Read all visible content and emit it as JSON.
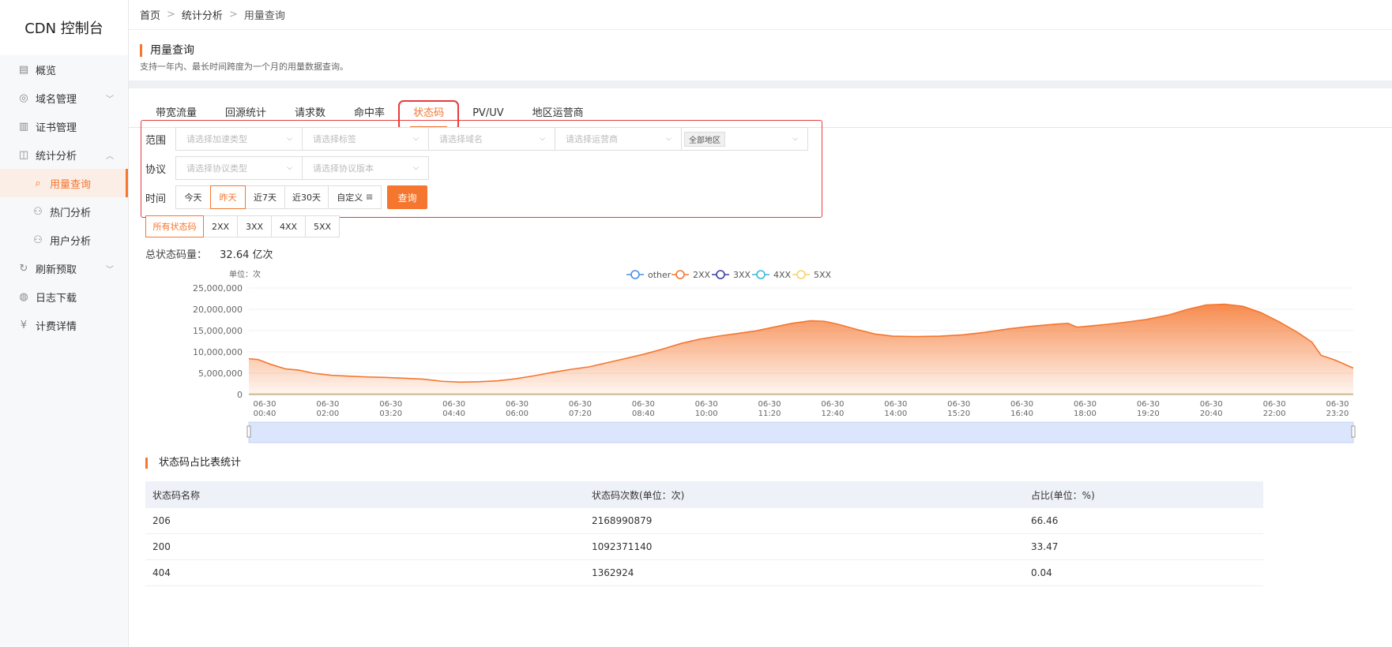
{
  "app": {
    "title": "CDN 控制台"
  },
  "sidebar": {
    "items": [
      {
        "label": "概览",
        "icon": "overview-icon"
      },
      {
        "label": "域名管理",
        "icon": "domain-icon",
        "expandable": true
      },
      {
        "label": "证书管理",
        "icon": "certificate-icon"
      },
      {
        "label": "统计分析",
        "icon": "stats-icon",
        "expandable": true,
        "expanded": true
      },
      {
        "label": "用量查询",
        "icon": "usage-icon",
        "sub": true,
        "active": true
      },
      {
        "label": "热门分析",
        "icon": "hot-icon",
        "sub": true
      },
      {
        "label": "用户分析",
        "icon": "user-icon",
        "sub": true
      },
      {
        "label": "刷新预取",
        "icon": "refresh-icon",
        "expandable": true
      },
      {
        "label": "日志下载",
        "icon": "log-icon"
      },
      {
        "label": "计费详情",
        "icon": "billing-icon"
      }
    ]
  },
  "breadcrumb": [
    "首页",
    "统计分析",
    "用量查询"
  ],
  "page": {
    "title": "用量查询",
    "desc": "支持一年内、最长时间跨度为一个月的用量数据查询。"
  },
  "tabs": [
    "带宽流量",
    "回源统计",
    "请求数",
    "命中率",
    "状态码",
    "PV/UV",
    "地区运营商"
  ],
  "active_tab": "状态码",
  "filters": {
    "scope_label": "范围",
    "scope": [
      "请选择加速类型",
      "请选择标签",
      "请选择域名",
      "请选择运营商"
    ],
    "region_tag": "全部地区",
    "protocol_label": "协议",
    "protocol": [
      "请选择协议类型",
      "请选择协议版本"
    ],
    "time_label": "时间",
    "time_buttons": [
      "今天",
      "昨天",
      "近7天",
      "近30天",
      "自定义"
    ],
    "time_selected": "昨天",
    "query_button": "查询"
  },
  "code_filters": [
    "所有状态码",
    "2XX",
    "3XX",
    "4XX",
    "5XX"
  ],
  "code_selected": "所有状态码",
  "total": {
    "label": "总状态码量：",
    "value": "32.64 亿次"
  },
  "chart_data": {
    "type": "area",
    "ylabel": "单位：次",
    "ylim": [
      0,
      25000000
    ],
    "yticks": [
      "25,000,000",
      "20,000,000",
      "15,000,000",
      "10,000,000",
      "5,000,000",
      "0"
    ],
    "xticks": [
      [
        "06-30",
        "00:40"
      ],
      [
        "06-30",
        "02:00"
      ],
      [
        "06-30",
        "03:20"
      ],
      [
        "06-30",
        "04:40"
      ],
      [
        "06-30",
        "06:00"
      ],
      [
        "06-30",
        "07:20"
      ],
      [
        "06-30",
        "08:40"
      ],
      [
        "06-30",
        "10:00"
      ],
      [
        "06-30",
        "11:20"
      ],
      [
        "06-30",
        "12:40"
      ],
      [
        "06-30",
        "14:00"
      ],
      [
        "06-30",
        "15:20"
      ],
      [
        "06-30",
        "16:40"
      ],
      [
        "06-30",
        "18:00"
      ],
      [
        "06-30",
        "19:20"
      ],
      [
        "06-30",
        "20:40"
      ],
      [
        "06-30",
        "22:00"
      ],
      [
        "06-30",
        "23:20"
      ]
    ],
    "legend": [
      "other",
      "2XX",
      "3XX",
      "4XX",
      "5XX"
    ],
    "legend_colors": [
      "#4a8fe7",
      "#f5762e",
      "#3b3fa8",
      "#3ab5e0",
      "#f5d36b"
    ],
    "series": [
      {
        "name": "2XX",
        "color": "#f5762e",
        "x_hours": [
          0,
          0.2,
          0.5,
          0.8,
          1.1,
          1.4,
          1.8,
          2.2,
          2.6,
          3.0,
          3.4,
          3.8,
          4.2,
          4.6,
          5.0,
          5.4,
          5.8,
          6.2,
          6.6,
          7.0,
          7.4,
          7.8,
          8.2,
          8.6,
          9.0,
          9.4,
          9.8,
          10.2,
          10.6,
          11.0,
          11.4,
          11.8,
          12.2,
          12.5,
          12.8,
          13.2,
          13.6,
          14.0,
          14.5,
          15.0,
          15.5,
          16.0,
          16.5,
          17.0,
          17.5,
          17.8,
          18.0,
          18.5,
          19.0,
          19.5,
          20.0,
          20.4,
          20.8,
          21.2,
          21.6,
          22.0,
          22.4,
          22.8,
          23.1,
          23.3,
          23.6,
          24.0
        ],
        "values": [
          8400000,
          8200000,
          7000000,
          6000000,
          5700000,
          5000000,
          4500000,
          4300000,
          4100000,
          4000000,
          3800000,
          3600000,
          3100000,
          2900000,
          3000000,
          3200000,
          3700000,
          4400000,
          5200000,
          5900000,
          6500000,
          7500000,
          8500000,
          9500000,
          10700000,
          12000000,
          13000000,
          13700000,
          14300000,
          14900000,
          15800000,
          16700000,
          17300000,
          17200000,
          16500000,
          15300000,
          14200000,
          13700000,
          13600000,
          13700000,
          14000000,
          14600000,
          15400000,
          16000000,
          16500000,
          16700000,
          15800000,
          16300000,
          16900000,
          17600000,
          18700000,
          20000000,
          21000000,
          21200000,
          20700000,
          19200000,
          17000000,
          14500000,
          12300000,
          9200000,
          8100000,
          6200000
        ]
      },
      {
        "name": "other",
        "color": "#4a8fe7",
        "values": [
          0
        ]
      },
      {
        "name": "3XX",
        "color": "#3b3fa8",
        "values": [
          0
        ]
      },
      {
        "name": "4XX",
        "color": "#3ab5e0",
        "values": [
          0
        ]
      },
      {
        "name": "5XX",
        "color": "#f5d36b",
        "values": [
          0
        ]
      }
    ]
  },
  "table": {
    "title": "状态码占比表统计",
    "headers": [
      "状态码名称",
      "状态码次数(单位：次)",
      "占比(单位：%)"
    ],
    "rows": [
      [
        "206",
        "2168990879",
        "66.46"
      ],
      [
        "200",
        "1092371140",
        "33.47"
      ],
      [
        "404",
        "1362924",
        "0.04"
      ]
    ]
  }
}
